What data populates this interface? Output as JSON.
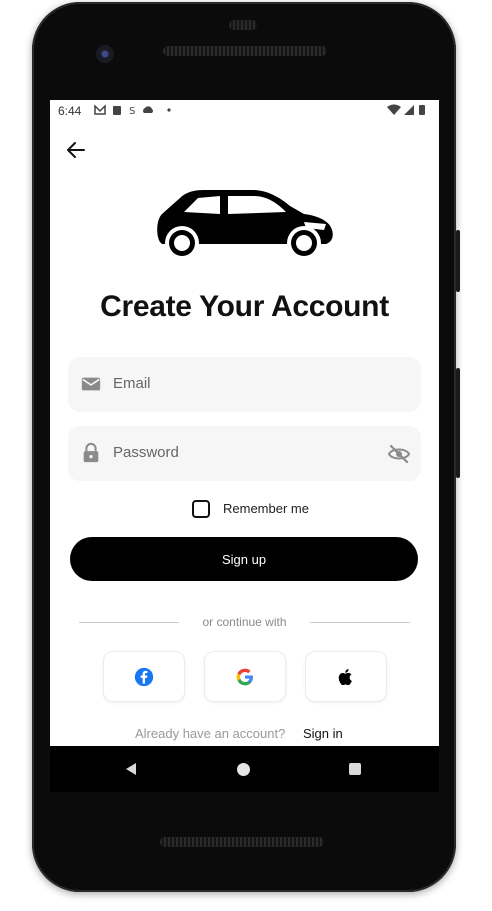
{
  "status_bar": {
    "time": "6:44"
  },
  "header": {
    "title": "Create Your Account"
  },
  "form": {
    "email": {
      "placeholder": "Email",
      "value": ""
    },
    "password": {
      "placeholder": "Password",
      "value": ""
    },
    "remember_label": "Remember me",
    "remember_checked": false,
    "signup_label": "Sign up"
  },
  "social": {
    "divider_text": "or continue with",
    "providers": [
      "facebook-icon",
      "google-icon",
      "apple-icon"
    ]
  },
  "footer": {
    "prompt": "Already have an account?",
    "signin_label": "Sign in"
  },
  "icons": {
    "back": "arrow-left-icon",
    "logo": "car-icon",
    "email": "mail-icon",
    "password": "lock-icon",
    "visibility": "eye-off-icon"
  },
  "colors": {
    "primary": "#000000",
    "field_bg": "#f6f6f6",
    "facebook": "#1877F2"
  }
}
